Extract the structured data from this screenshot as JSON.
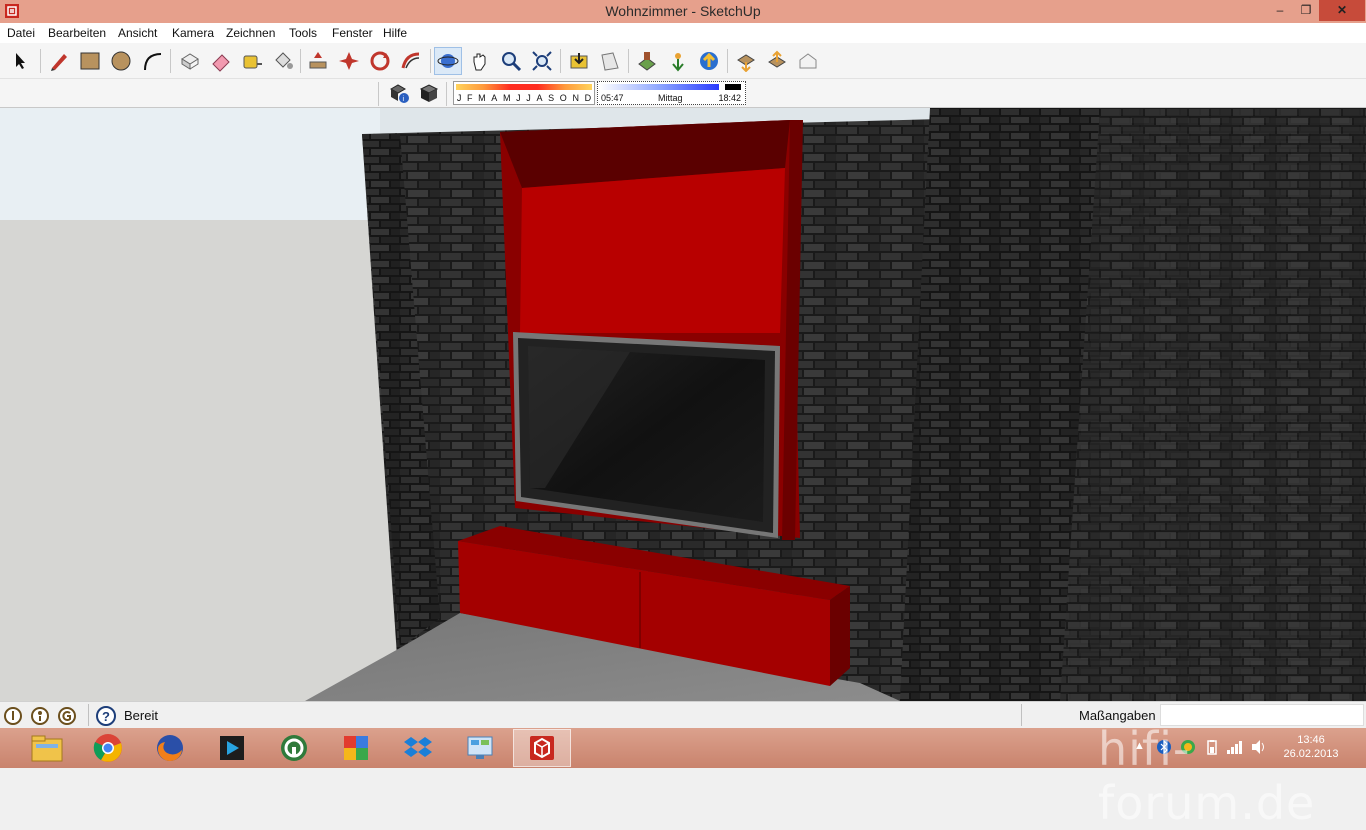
{
  "window": {
    "title": "Wohnzimmer - SketchUp",
    "controls": {
      "minimize": "–",
      "maximize": "❐",
      "close": "✕"
    }
  },
  "menu": [
    "Datei",
    "Bearbeiten",
    "Ansicht",
    "Kamera",
    "Zeichnen",
    "Tools",
    "Fenster",
    "Hilfe"
  ],
  "toolbar": {
    "tools": [
      "select-icon",
      "pencil-icon",
      "rectangle-icon",
      "circle-icon",
      "arc-icon",
      "push-pull-icon",
      "eraser-icon",
      "tape-measure-icon",
      "paint-bucket-icon",
      "move-icon",
      "rotate-icon",
      "offset-icon",
      "follow-me-icon",
      "orbit-icon",
      "pan-icon",
      "zoom-icon",
      "zoom-extents-icon",
      "previous-view-icon",
      "next-view-icon",
      "add-location-icon",
      "get-models-icon",
      "share-model-icon",
      "get-components-icon",
      "share-component-icon",
      "3d-warehouse-icon"
    ]
  },
  "shadows": {
    "months": [
      "J",
      "F",
      "M",
      "A",
      "M",
      "J",
      "J",
      "A",
      "S",
      "O",
      "N",
      "D"
    ],
    "time_start": "05:47",
    "time_mid": "Mittag",
    "time_end": "18:42"
  },
  "status": {
    "text": "Bereit",
    "measurements_label": "Maßangaben",
    "measurements_value": ""
  },
  "taskbar": {
    "apps": [
      "explorer-icon",
      "chrome-icon",
      "firefox-icon",
      "media-player-icon",
      "green-app-icon",
      "puzzle-app-icon",
      "dropbox-icon",
      "control-panel-icon",
      "sketchup-icon"
    ],
    "active": "sketchup-icon",
    "time": "13:46",
    "date": "26.02.2013"
  },
  "watermark": "hifi-forum.de",
  "colors": {
    "accent_red": "#a40000",
    "titlebar": "#e6a08c",
    "close": "#c74b3a"
  }
}
